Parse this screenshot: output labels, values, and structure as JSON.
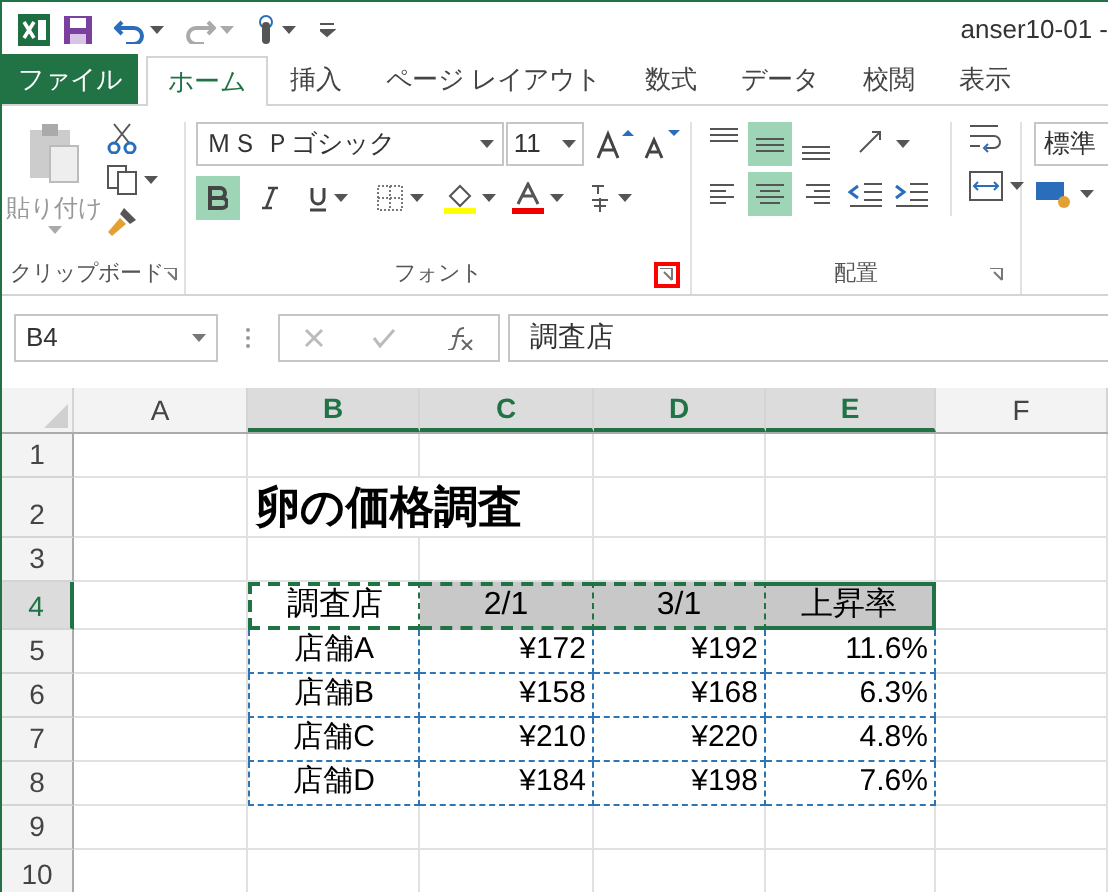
{
  "title_bar": {
    "title": "anser10-01 -"
  },
  "ribbon_tabs": [
    {
      "label": "ファイル",
      "kind": "file",
      "selected": false
    },
    {
      "label": "ホーム",
      "kind": "tab",
      "selected": true
    },
    {
      "label": "挿入",
      "kind": "tab",
      "selected": false
    },
    {
      "label": "ページ レイアウト",
      "kind": "tab",
      "selected": false
    },
    {
      "label": "数式",
      "kind": "tab",
      "selected": false
    },
    {
      "label": "データ",
      "kind": "tab",
      "selected": false
    },
    {
      "label": "校閲",
      "kind": "tab",
      "selected": false
    },
    {
      "label": "表示",
      "kind": "tab",
      "selected": false
    }
  ],
  "ribbon": {
    "clipboard": {
      "paste_label": "貼り付け",
      "group_label": "クリップボード"
    },
    "font": {
      "font_name": "ＭＳ Ｐゴシック",
      "font_size": "11",
      "bold": true,
      "italic": false,
      "underline": false,
      "group_label": "フォント",
      "launcher_highlighted": true
    },
    "alignment": {
      "vertical": [
        {
          "kind": "top",
          "selected": false
        },
        {
          "kind": "middle",
          "selected": true
        },
        {
          "kind": "bottom",
          "selected": false
        }
      ],
      "horizontal": [
        {
          "kind": "left",
          "selected": false
        },
        {
          "kind": "center",
          "selected": true
        },
        {
          "kind": "right",
          "selected": false
        }
      ],
      "group_label": "配置"
    },
    "number": {
      "format": "標準"
    }
  },
  "formula_bar": {
    "name_box": "B4",
    "formula": "調査店"
  },
  "sheet": {
    "columns": [
      {
        "label": "A",
        "selected": false
      },
      {
        "label": "B",
        "selected": true
      },
      {
        "label": "C",
        "selected": true
      },
      {
        "label": "D",
        "selected": true
      },
      {
        "label": "E",
        "selected": true
      },
      {
        "label": "F",
        "selected": false
      }
    ],
    "rows": [
      {
        "label": "1",
        "selected": false
      },
      {
        "label": "2",
        "selected": false
      },
      {
        "label": "3",
        "selected": false
      },
      {
        "label": "4",
        "selected": true
      },
      {
        "label": "5",
        "selected": false
      },
      {
        "label": "6",
        "selected": false
      },
      {
        "label": "7",
        "selected": false
      },
      {
        "label": "8",
        "selected": false
      },
      {
        "label": "9",
        "selected": false
      },
      {
        "label": "10",
        "selected": false
      }
    ],
    "title": "卵の価格調査",
    "table": {
      "header": [
        {
          "text": "調査店",
          "selected": false
        },
        {
          "text": "2/1",
          "selected": true
        },
        {
          "text": "3/1",
          "selected": true
        },
        {
          "text": "上昇率",
          "selected": true
        }
      ],
      "rows": [
        [
          "店舗A",
          "¥172",
          "¥192",
          "11.6%"
        ],
        [
          "店舗B",
          "¥158",
          "¥168",
          "6.3%"
        ],
        [
          "店舗C",
          "¥210",
          "¥220",
          "4.8%"
        ],
        [
          "店舗D",
          "¥184",
          "¥198",
          "7.6%"
        ]
      ]
    }
  }
}
